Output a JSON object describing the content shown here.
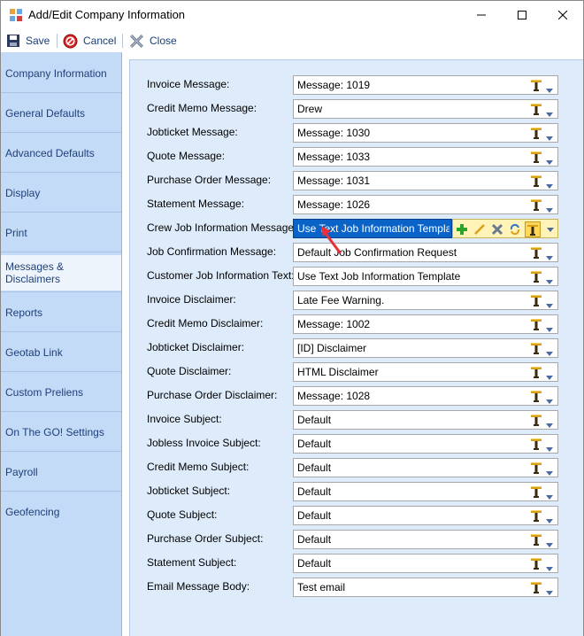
{
  "window": {
    "title": "Add/Edit Company Information"
  },
  "toolbar": {
    "save_label": "Save",
    "cancel_label": "Cancel",
    "close_label": "Close"
  },
  "sidebar": {
    "items": [
      {
        "label": "Company Information"
      },
      {
        "label": "General Defaults"
      },
      {
        "label": "Advanced Defaults"
      },
      {
        "label": "Display"
      },
      {
        "label": "Print"
      },
      {
        "label": "Messages & Disclaimers"
      },
      {
        "label": "Reports"
      },
      {
        "label": "Geotab Link"
      },
      {
        "label": "Custom Preliens"
      },
      {
        "label": "On The GO! Settings"
      },
      {
        "label": "Payroll"
      },
      {
        "label": "Geofencing"
      }
    ],
    "active_index": 5
  },
  "fields": [
    {
      "label": "Invoice Message:",
      "value": "Message: 1019"
    },
    {
      "label": "Credit Memo Message:",
      "value": "Drew"
    },
    {
      "label": "Jobticket Message:",
      "value": "Message: 1030"
    },
    {
      "label": "Quote Message:",
      "value": "Message: 1033"
    },
    {
      "label": "Purchase Order Message:",
      "value": "Message: 1031"
    },
    {
      "label": "Statement Message:",
      "value": "Message: 1026"
    },
    {
      "label": "Crew Job Information Message:",
      "value": "Use Text Job Information Templat"
    },
    {
      "label": "Job Confirmation Message:",
      "value": "Default Job Confirmation Request"
    },
    {
      "label": "Customer Job Information Text:",
      "value": "Use Text Job Information Template"
    },
    {
      "label": "Invoice Disclaimer:",
      "value": "Late Fee Warning."
    },
    {
      "label": "Credit Memo Disclaimer:",
      "value": "Message: 1002"
    },
    {
      "label": "Jobticket Disclaimer:",
      "value": "[ID] Disclaimer"
    },
    {
      "label": "Quote Disclaimer:",
      "value": "HTML Disclaimer"
    },
    {
      "label": "Purchase Order Disclaimer:",
      "value": "Message: 1028"
    },
    {
      "label": "Invoice Subject:",
      "value": "Default"
    },
    {
      "label": "Jobless Invoice Subject:",
      "value": "Default"
    },
    {
      "label": "Credit Memo Subject:",
      "value": "Default"
    },
    {
      "label": "Jobticket Subject:",
      "value": "Default"
    },
    {
      "label": "Quote Subject:",
      "value": "Default"
    },
    {
      "label": "Purchase Order Subject:",
      "value": "Default"
    },
    {
      "label": "Statement Subject:",
      "value": "Default"
    },
    {
      "label": "Email Message Body:",
      "value": "Test email"
    }
  ],
  "active_field_index": 6,
  "tool_strip": [
    "add-icon",
    "edit-icon",
    "delete-icon",
    "refresh-icon",
    "lamp-icon",
    "dropdown-icon"
  ],
  "colors": {
    "sidebar_bg": "#c3dbf6",
    "panel_bg": "#ddebfa",
    "selected_combo": "#0a64c8",
    "tool_strip_bg": "#fff3b8",
    "annotation_arrow": "#e8303a"
  }
}
